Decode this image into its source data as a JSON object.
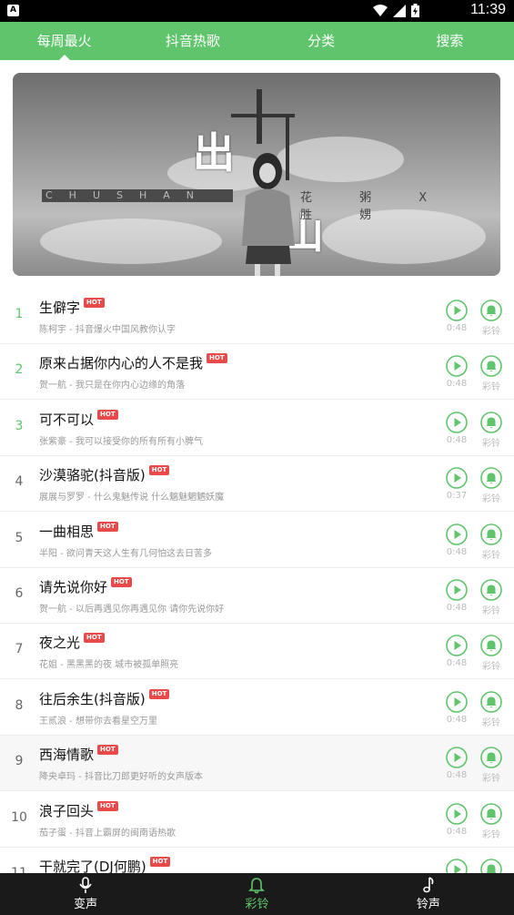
{
  "status_bar": {
    "time": "11:39",
    "notification": "A"
  },
  "colors": {
    "accent": "#5fc46b",
    "hot_badge": "#e84a4a",
    "bottom_nav_bg": "#1a1a1a"
  },
  "top_nav": {
    "tabs": [
      {
        "label": "每周最火",
        "active": true
      },
      {
        "label": "抖音热歌",
        "active": false
      },
      {
        "label": "分类",
        "active": false
      },
      {
        "label": "搜索",
        "active": false
      }
    ]
  },
  "banner": {
    "title_chars": [
      "出",
      "山"
    ],
    "pinyin": "CHUSHAN",
    "credits": "花 粥 X 胜 娚"
  },
  "hot_label": "HOT",
  "ringtone_label": "彩铃",
  "songs": [
    {
      "num": "1",
      "title": "生僻字",
      "subtitle": "陈柯宇 - 抖音爆火中国风教你认字",
      "duration": "0:48"
    },
    {
      "num": "2",
      "title": "原来占据你内心的人不是我",
      "subtitle": "贺一航 - 我只是在你内心边缘的角落",
      "duration": "0:48"
    },
    {
      "num": "3",
      "title": "可不可以",
      "subtitle": "张紫豪 - 我可以接受你的所有所有小脾气",
      "duration": "0:48"
    },
    {
      "num": "4",
      "title": "沙漠骆驼(抖音版)",
      "subtitle": "展展与罗罗 - 什么鬼魅传说 什么魑魅魍魉妖魔",
      "duration": "0:37"
    },
    {
      "num": "5",
      "title": "一曲相思",
      "subtitle": "半阳 - 欲问青天这人生有几何怕这去日苦多",
      "duration": "0:48"
    },
    {
      "num": "6",
      "title": "请先说你好",
      "subtitle": "贺一航 - 以后再遇见你再遇见你 请你先说你好",
      "duration": "0:48"
    },
    {
      "num": "7",
      "title": "夜之光",
      "subtitle": "花姐 - 黑黑黑的夜 城市被孤单照亮",
      "duration": "0:48"
    },
    {
      "num": "8",
      "title": "往后余生(抖音版)",
      "subtitle": "王贰浪 - 想带你去看星空万里",
      "duration": "0:48"
    },
    {
      "num": "9",
      "title": "西海情歌",
      "subtitle": "降央卓玛 - 抖音比刀郎更好听的女声版本",
      "duration": "0:48"
    },
    {
      "num": "10",
      "title": "浪子回头",
      "subtitle": "茄子蛋 - 抖音上霸屏的闽南语热歌",
      "duration": "0:48"
    },
    {
      "num": "11",
      "title": "干就完了(DJ何鹏)",
      "subtitle": "",
      "duration": ""
    }
  ],
  "bottom_nav": {
    "items": [
      {
        "label": "变声",
        "icon": "voice-changer-icon",
        "active": false
      },
      {
        "label": "彩铃",
        "icon": "bell-icon",
        "active": true
      },
      {
        "label": "铃声",
        "icon": "music-note-icon",
        "active": false
      }
    ]
  }
}
